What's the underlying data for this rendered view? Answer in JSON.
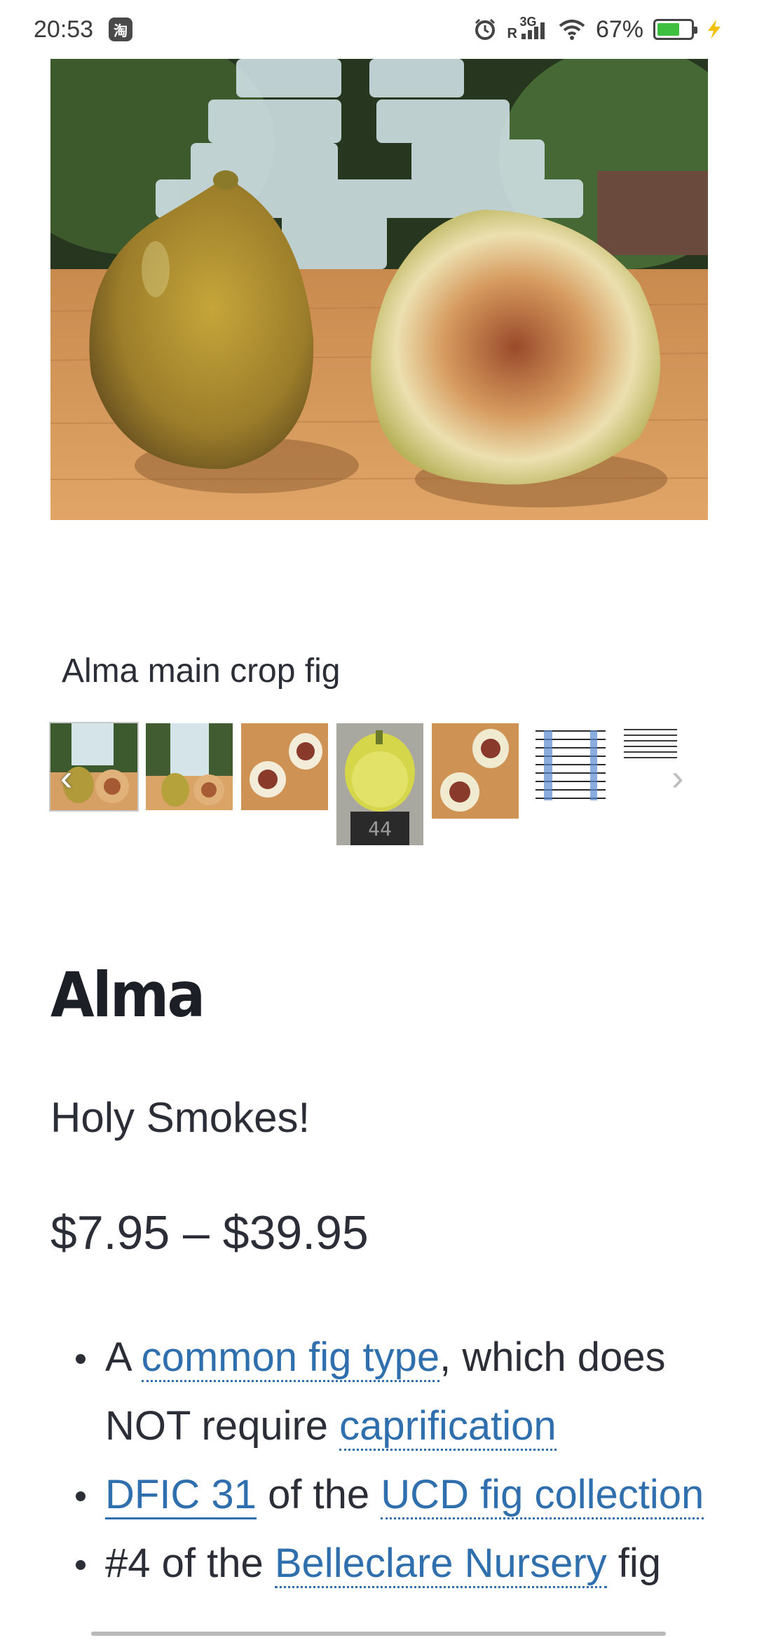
{
  "status_bar": {
    "time": "20:53",
    "app_badge": "淘",
    "network": "3G",
    "roaming": "R",
    "battery_percent": "67%",
    "battery_level": 0.67,
    "icons": [
      "alarm-icon",
      "signal-icon",
      "wifi-icon",
      "battery-icon",
      "charging-icon"
    ]
  },
  "gallery": {
    "caption": "Alma main crop fig",
    "selected_index": 0,
    "thumbnails": [
      {
        "label": "thumbnail-1"
      },
      {
        "label": "thumbnail-2"
      },
      {
        "label": "thumbnail-3"
      },
      {
        "label": "thumbnail-4",
        "scale_reading": "44"
      },
      {
        "label": "thumbnail-5"
      },
      {
        "label": "thumbnail-6"
      },
      {
        "label": "thumbnail-7"
      }
    ]
  },
  "product": {
    "title": "Alma",
    "subtitle": "Holy Smokes!",
    "price": "$7.95 – $39.95"
  },
  "features": {
    "item1": {
      "prefix": "A ",
      "link1": "common fig type",
      "middle": ", which does NOT require ",
      "link2": "caprification"
    },
    "item2": {
      "link1": "DFIC 31",
      "middle": " of the ",
      "link2": "UCD fig collection"
    },
    "item3": {
      "prefix": "#4 of the ",
      "link1": "Belleclare Nursery",
      "suffix": " fig"
    }
  },
  "colors": {
    "link": "#2f6fae",
    "text": "#2b2e36",
    "battery": "#3fbf3f",
    "charging": "#f2c200"
  }
}
